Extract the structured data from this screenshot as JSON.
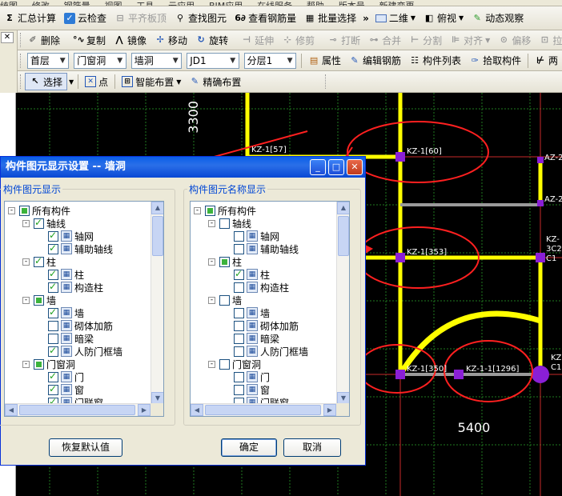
{
  "menu": [
    "统图",
    "修改",
    "钢筋量",
    "视图",
    "工具",
    "云应用",
    "BIM应用",
    "在线服务",
    "帮助",
    "版本号",
    "新建变更"
  ],
  "toolbar1": {
    "sum_label": "汇总计算",
    "cloud_check_label": "云检查",
    "flat_top_label": "平齐板顶",
    "find_label": "查找图元",
    "view_rebar_label": "查看钢筋量",
    "batch_select_label": "批量选择",
    "view2d_label": "二维",
    "view_label": "俯视",
    "dyn_view_label": "动态观察"
  },
  "toolbar2": {
    "delete": "删除",
    "copy": "复制",
    "mirror": "镜像",
    "move": "移动",
    "rotate": "旋转",
    "extend": "延伸",
    "trim": "修剪",
    "break": "打断",
    "merge": "合并",
    "split": "分割",
    "align": "对齐",
    "offset": "偏移",
    "more": "拉"
  },
  "toolbar3": {
    "floor": "首层",
    "category": "门窗洞",
    "type": "墙洞",
    "element": "JD1",
    "layer": "分层1",
    "property": "属性",
    "edit_rebar": "编辑钢筋",
    "list": "构件列表",
    "pick": "拾取构件",
    "two_point": "两"
  },
  "toolbar4": {
    "select": "选择",
    "point": "点",
    "smart": "智能布置",
    "precise": "精确布置"
  },
  "canvas": {
    "dims": [
      "3300",
      "5400"
    ],
    "labels": [
      "KZ-1[57]",
      "KZ-1[60]",
      "AZ-2",
      "AZ-2",
      "KZ-1[353]",
      "KZ-",
      "3C2",
      "C1",
      "KZ-1[350]",
      "KZ-1-1[1296]",
      "KZ",
      "C1"
    ]
  },
  "dialog": {
    "title": "构件图元显示设置  --  墙洞",
    "left_group": "构件图元显示",
    "right_group": "构件图元名称显示",
    "restore_button": "恢复默认值",
    "ok_button": "确定",
    "cancel_button": "取消",
    "left_tree": [
      {
        "label": "所有构件",
        "level": 0,
        "state": "partial",
        "expand": "-"
      },
      {
        "label": "轴线",
        "level": 1,
        "state": "checked",
        "expand": "-"
      },
      {
        "label": "轴网",
        "level": 2,
        "state": "checked",
        "icon": "轴"
      },
      {
        "label": "辅助轴线",
        "level": 2,
        "state": "checked",
        "icon": "辅"
      },
      {
        "label": "柱",
        "level": 1,
        "state": "checked",
        "expand": "-"
      },
      {
        "label": "柱",
        "level": 2,
        "state": "checked",
        "icon": "柱"
      },
      {
        "label": "构造柱",
        "level": 2,
        "state": "checked",
        "icon": "构"
      },
      {
        "label": "墙",
        "level": 1,
        "state": "partial",
        "expand": "-"
      },
      {
        "label": "墙",
        "level": 2,
        "state": "checked",
        "icon": "墙"
      },
      {
        "label": "砌体加筋",
        "level": 2,
        "state": "unchecked",
        "icon": "砌"
      },
      {
        "label": "暗梁",
        "level": 2,
        "state": "unchecked",
        "icon": "暗"
      },
      {
        "label": "人防门框墙",
        "level": 2,
        "state": "checked",
        "icon": "人"
      },
      {
        "label": "门窗洞",
        "level": 1,
        "state": "partial",
        "expand": "-"
      },
      {
        "label": "门",
        "level": 2,
        "state": "checked",
        "icon": "门"
      },
      {
        "label": "窗",
        "level": 2,
        "state": "checked",
        "icon": "窗"
      },
      {
        "label": "门联窗",
        "level": 2,
        "state": "checked",
        "icon": "联"
      }
    ],
    "right_tree": [
      {
        "label": "所有构件",
        "level": 0,
        "state": "partial",
        "expand": "-"
      },
      {
        "label": "轴线",
        "level": 1,
        "state": "unchecked",
        "expand": "-"
      },
      {
        "label": "轴网",
        "level": 2,
        "state": "unchecked",
        "icon": "轴"
      },
      {
        "label": "辅助轴线",
        "level": 2,
        "state": "unchecked",
        "icon": "辅"
      },
      {
        "label": "柱",
        "level": 1,
        "state": "partial",
        "expand": "-"
      },
      {
        "label": "柱",
        "level": 2,
        "state": "checked",
        "icon": "柱"
      },
      {
        "label": "构造柱",
        "level": 2,
        "state": "unchecked",
        "icon": "构"
      },
      {
        "label": "墙",
        "level": 1,
        "state": "unchecked",
        "expand": "-"
      },
      {
        "label": "墙",
        "level": 2,
        "state": "unchecked",
        "icon": "墙"
      },
      {
        "label": "砌体加筋",
        "level": 2,
        "state": "unchecked",
        "icon": "砌"
      },
      {
        "label": "暗梁",
        "level": 2,
        "state": "unchecked",
        "icon": "暗"
      },
      {
        "label": "人防门框墙",
        "level": 2,
        "state": "unchecked",
        "icon": "人"
      },
      {
        "label": "门窗洞",
        "level": 1,
        "state": "unchecked",
        "expand": "-"
      },
      {
        "label": "门",
        "level": 2,
        "state": "unchecked",
        "icon": "门"
      },
      {
        "label": "窗",
        "level": 2,
        "state": "unchecked",
        "icon": "窗"
      },
      {
        "label": "门联窗",
        "level": 2,
        "state": "unchecked",
        "icon": "联"
      }
    ]
  }
}
